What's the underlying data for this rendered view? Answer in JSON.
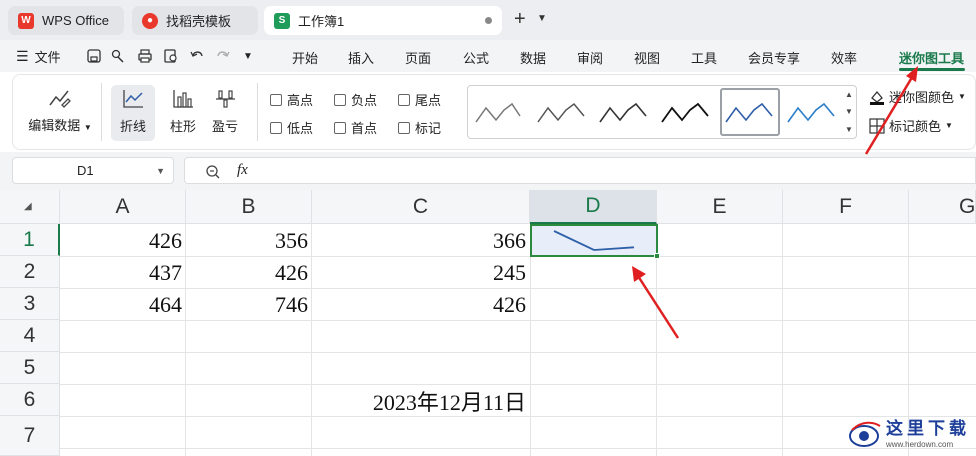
{
  "tabs": [
    {
      "label": "WPS Office",
      "icon": "wps-logo-icon"
    },
    {
      "label": "找稻壳模板",
      "icon": "docer-icon"
    },
    {
      "label": "工作簿1",
      "icon": "spreadsheet-s-icon",
      "badge": "S"
    }
  ],
  "menu": {
    "file": "文件",
    "items": [
      "开始",
      "插入",
      "页面",
      "公式",
      "数据",
      "审阅",
      "视图",
      "工具",
      "会员专享",
      "效率",
      "迷你图工具"
    ],
    "active": "迷你图工具"
  },
  "ribbon": {
    "edit_data": "编辑数据",
    "types": [
      "折线",
      "柱形",
      "盈亏"
    ],
    "selected_type": "折线",
    "checkboxes": [
      "高点",
      "负点",
      "尾点",
      "低点",
      "首点",
      "标记"
    ],
    "sparkline_color": "迷你图颜色",
    "marker_color": "标记颜色"
  },
  "formula_bar": {
    "cell_ref": "D1",
    "fx": "fx",
    "content": ""
  },
  "sheet": {
    "columns": [
      "A",
      "B",
      "C",
      "D",
      "E",
      "F",
      "G"
    ],
    "rows": [
      "1",
      "2",
      "3",
      "4",
      "5",
      "6",
      "7"
    ],
    "cells": {
      "A1": "426",
      "B1": "356",
      "C1": "366",
      "A2": "437",
      "B2": "426",
      "C2": "245",
      "A3": "464",
      "B3": "746",
      "C3": "426",
      "C6": "2023年12月11日"
    },
    "sparkline_values": [
      426,
      356,
      366
    ],
    "selected_cell": "D1"
  },
  "watermark": {
    "text": "这里下载",
    "url": "www.herdown.com"
  },
  "colors": {
    "accent": "#1a7a4b",
    "arrow": "#e02020",
    "sparkline": "#2e5fa8"
  }
}
